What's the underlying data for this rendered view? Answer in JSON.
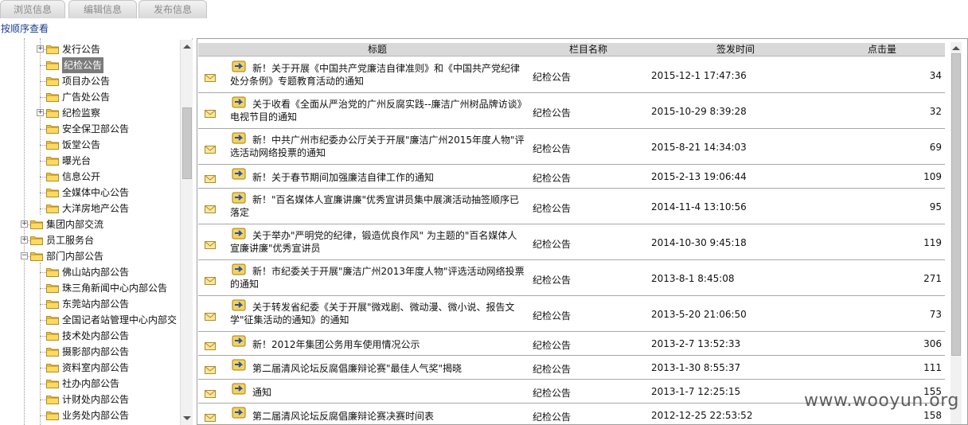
{
  "tabs": [
    "浏览信息",
    "编辑信息",
    "发布信息"
  ],
  "order_link": "按顺序查看",
  "tree": [
    {
      "label": "发行公告",
      "indent": 2,
      "expander": "+"
    },
    {
      "label": "纪检公告",
      "indent": 2,
      "selected": true
    },
    {
      "label": "项目办公告",
      "indent": 2
    },
    {
      "label": "广告处公告",
      "indent": 2
    },
    {
      "label": "纪检监察",
      "indent": 2,
      "expander": "+"
    },
    {
      "label": "安全保卫部公告",
      "indent": 2
    },
    {
      "label": "饭堂公告",
      "indent": 2
    },
    {
      "label": "曝光台",
      "indent": 2
    },
    {
      "label": "信息公开",
      "indent": 2
    },
    {
      "label": "全媒体中心公告",
      "indent": 2
    },
    {
      "label": "大洋房地产公告",
      "indent": 2
    },
    {
      "label": "集团内部交流",
      "indent": 1,
      "expander": "+"
    },
    {
      "label": "员工服务台",
      "indent": 1,
      "expander": "+"
    },
    {
      "label": "部门内部公告",
      "indent": 1,
      "expander": "-"
    },
    {
      "label": "佛山站内部公告",
      "indent": 2
    },
    {
      "label": "珠三角新闻中心内部公告",
      "indent": 2
    },
    {
      "label": "东莞站内部公告",
      "indent": 2
    },
    {
      "label": "全国记者站管理中心内部交",
      "indent": 2
    },
    {
      "label": "技术处内部公告",
      "indent": 2
    },
    {
      "label": "摄影部内部公告",
      "indent": 2
    },
    {
      "label": "资料室内部公告",
      "indent": 2
    },
    {
      "label": "社办内部公告",
      "indent": 2
    },
    {
      "label": "计财处内部公告",
      "indent": 2
    },
    {
      "label": "业务处内部公告",
      "indent": 2
    }
  ],
  "table": {
    "headers": [
      "标题",
      "栏目名称",
      "签发时间",
      "点击量"
    ],
    "rows": [
      {
        "title": "新！关于开展《中国共产党廉洁自律准则》和《中国共产党纪律处分条例》专题教育活动的通知",
        "column": "纪检公告",
        "date": "2015-12-1 17:47:36",
        "clicks": "34"
      },
      {
        "title": "关于收看《全面从严治党的广州反腐实践--廉洁广州树品牌访谈》电视节目的通知",
        "column": "纪检公告",
        "date": "2015-10-29 8:39:28",
        "clicks": "32"
      },
      {
        "title": "新！中共广州市纪委办公厅关于开展\"廉洁广州2015年度人物\"评选活动网络投票的通知",
        "column": "纪检公告",
        "date": "2015-8-21 14:34:03",
        "clicks": "69"
      },
      {
        "title": "新！关于春节期间加强廉洁自律工作的通知",
        "column": "纪检公告",
        "date": "2015-2-13 19:06:44",
        "clicks": "109"
      },
      {
        "title": "新！\"百名媒体人宣廉讲廉\"优秀宣讲员集中展演活动抽签顺序已落定",
        "column": "纪检公告",
        "date": "2014-11-4 13:10:56",
        "clicks": "95"
      },
      {
        "title": "关于举办\"严明党的纪律，锻造优良作风\" 为主题的\"百名媒体人宣廉讲廉\"优秀宣讲员",
        "column": "纪检公告",
        "date": "2014-10-30 9:45:18",
        "clicks": "119"
      },
      {
        "title": "新！市纪委关于开展\"廉洁广州2013年度人物\"评选活动网络投票的通知",
        "column": "纪检公告",
        "date": "2013-8-1 8:45:08",
        "clicks": "271"
      },
      {
        "title": "关于转发省纪委《关于开展\"微戏剧、微动漫、微小说、报告文学\"征集活动的通知》的通知",
        "column": "纪检公告",
        "date": "2013-5-20 21:06:50",
        "clicks": "73"
      },
      {
        "title": "新！2012年集团公务用车使用情况公示",
        "column": "纪检公告",
        "date": "2013-2-7 13:52:33",
        "clicks": "306"
      },
      {
        "title": "第二届清风论坛反腐倡廉辩论赛\"最佳人气奖\"揭晓",
        "column": "纪检公告",
        "date": "2013-1-30 8:55:37",
        "clicks": "111"
      },
      {
        "title": "通知",
        "column": "纪检公告",
        "date": "2013-1-7 12:25:15",
        "clicks": "155"
      },
      {
        "title": "第二届清风论坛反腐倡廉辩论赛决赛时间表",
        "column": "纪检公告",
        "date": "2012-12-25 22:53:52",
        "clicks": "158"
      }
    ]
  },
  "watermark": "www.wooyun.org",
  "colors": {
    "header_bg": "#d9d9d9",
    "selected_bg": "#7b7b7b",
    "link": "#1a3f8f",
    "folder": "#f5c945"
  }
}
